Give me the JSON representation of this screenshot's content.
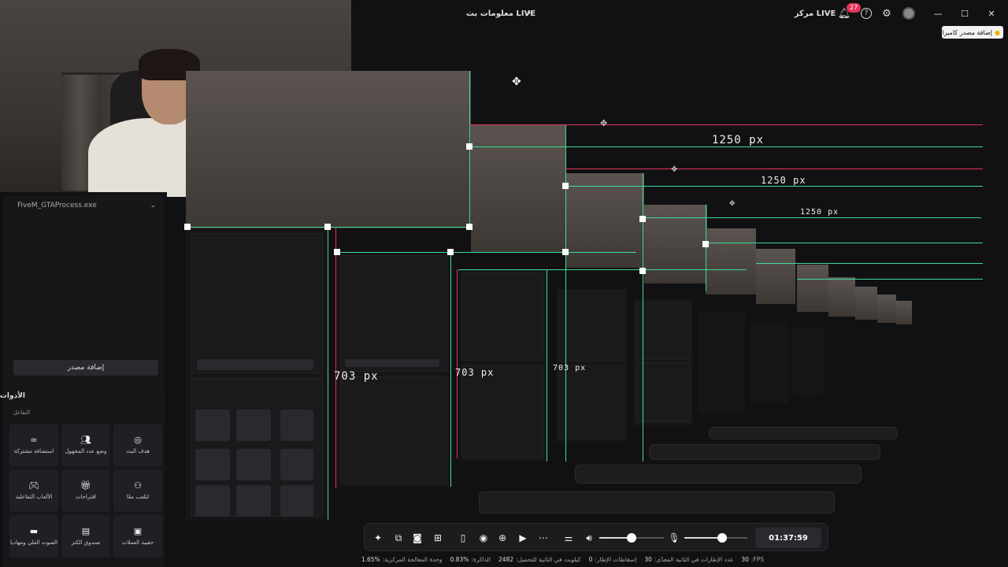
{
  "titlebar": {
    "stream_title": "معلومات بث LIVE",
    "hub_label": "مركز LIVE",
    "notification_count": "27",
    "help_glyph": "?",
    "min_glyph": "—",
    "max_glyph": "☐",
    "close_glyph": "✕"
  },
  "toast": {
    "text": "إضافة مصدر كاميرا"
  },
  "sources": {
    "item_name": "FiveM_GTAProcess.exe",
    "add_source_label": "إضافة مصدر"
  },
  "tools": {
    "title": "الأدوات",
    "subtitle": "التفاعل",
    "items": [
      {
        "label": "هدف البث",
        "icon": "target-icon"
      },
      {
        "label": "وضع عدد المجهول",
        "icon": "users-icon"
      },
      {
        "label": "استضافة مشتركة",
        "icon": "link-icon"
      },
      {
        "label": "لتلعب معًا",
        "icon": "gamepad-user-icon"
      },
      {
        "label": "اقتراحات",
        "icon": "gift-icon"
      },
      {
        "label": "الألعاب التفاعلية",
        "icon": "gamepad-icon"
      },
      {
        "label": "حقيبة العملات",
        "icon": "bag-icon"
      },
      {
        "label": "صندوق الكنز",
        "icon": "chest-icon"
      },
      {
        "label": "الصوت العلي ومهاديا",
        "icon": "voice-icon"
      }
    ]
  },
  "preview": {
    "width_label": "1250 px",
    "height_label": "703 px"
  },
  "control_bar": {
    "timer": "01:37:59",
    "volume_level": 0.5,
    "mic_level": 0.6
  },
  "status": {
    "fps_label": "FPS:",
    "fps_value": "30",
    "dropped_label": "عدد الإطارات في الثانية المعدّى:",
    "dropped_value": "30",
    "skipped_label": "إسقاطات الإطار:",
    "skipped_value": "0",
    "bitrate_label": "كيلوبت في الثانية للتحميل:",
    "bitrate_value": "2482",
    "memory_label": "الذاكرة:",
    "memory_value": "0.83%",
    "cpu_label": "وحدة المعالجة المركزية:",
    "cpu_value": "1.65%"
  }
}
